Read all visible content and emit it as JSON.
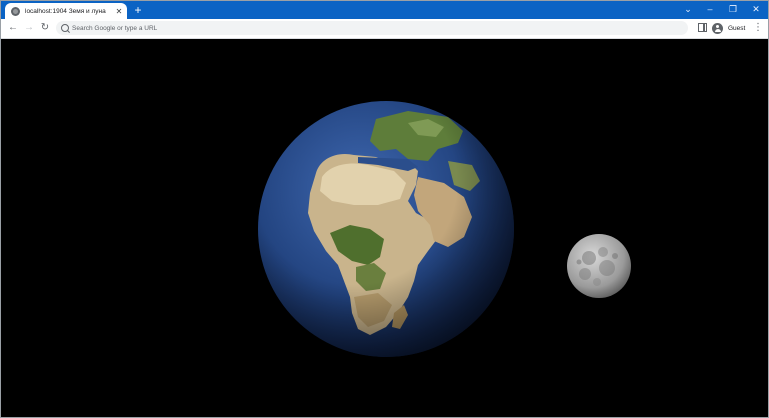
{
  "browser": {
    "tab": {
      "title": "localhost:1904 Земя и луна",
      "favicon": "globe-icon",
      "close_glyph": "✕"
    },
    "new_tab_glyph": "+",
    "window_controls": {
      "dropdown": "⌄",
      "minimize": "–",
      "restore": "❐",
      "close": "✕"
    },
    "toolbar": {
      "back_glyph": "←",
      "forward_glyph": "→",
      "reload_glyph": "↻",
      "omnibox_placeholder": "Search Google or type a URL",
      "profile_label": "Guest",
      "menu_glyph": "⋮"
    },
    "colors": {
      "tabstrip": "#0b63c4",
      "toolbar": "#ffffff",
      "page_background": "#000000"
    }
  },
  "scene": {
    "bodies": [
      {
        "name": "earth",
        "kind": "textured-sphere"
      },
      {
        "name": "moon",
        "kind": "textured-sphere"
      }
    ]
  }
}
